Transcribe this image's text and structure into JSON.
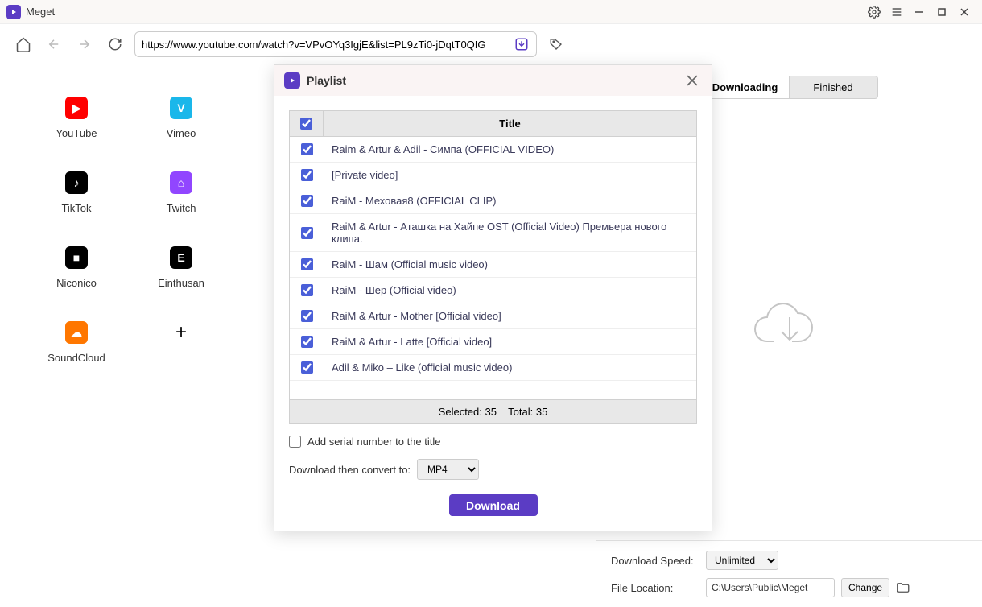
{
  "app": {
    "name": "Meget"
  },
  "toolbar": {
    "url": "https://www.youtube.com/watch?v=VPvOYq3IgjE&list=PL9zTi0-jDqtT0QIG"
  },
  "sites": [
    "YouTube",
    "Vimeo",
    "TikTok",
    "Twitch",
    "Niconico",
    "Einthusan",
    "SoundCloud"
  ],
  "tabs": {
    "downloading": "Downloading",
    "finished": "Finished"
  },
  "settings": {
    "speed_label": "Download Speed:",
    "speed_value": "Unlimited",
    "location_label": "File Location:",
    "location_value": "C:\\Users\\Public\\Meget",
    "change": "Change"
  },
  "modal": {
    "title": "Playlist",
    "col_title": "Title",
    "rows": [
      "Raim & Artur & Adil - Симпа (OFFICIAL VIDEO)",
      "[Private video]",
      "RaiM - Меховая8 (OFFICIAL CLIP)",
      "RaiM & Artur - Аташка на Хайпе OST (Official Video) Премьера нового клипа.",
      "RaiM - Шам (Official music video)",
      "RaiM - Шер (Official video)",
      "RaiM & Artur - Mother [Official video]",
      "RaiM & Artur - Latte [Official video]",
      "Adil & Miko – Like (official music video)"
    ],
    "selected": 35,
    "total": 35,
    "footer_selected": "Selected: 35",
    "footer_total": "Total: 35",
    "serial_label": "Add serial number to the title",
    "convert_label": "Download then convert to:",
    "convert_value": "MP4",
    "download": "Download"
  }
}
